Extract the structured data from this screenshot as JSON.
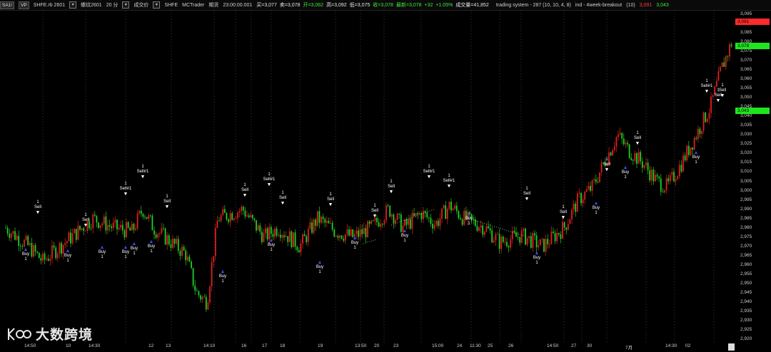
{
  "header": {
    "symbol_badge": "SA1!",
    "mode_badge": "VP",
    "symbol": "SHFE.rb 2601",
    "contract": "螺纹2601",
    "period": "20 分",
    "tabs_label": "成交价",
    "exchange": "SHFE",
    "app": "MCTrader",
    "sim": "期货",
    "time": "23:00:00.001",
    "fields": [
      {
        "label": "买",
        "value": "3,077",
        "tone": "w"
      },
      {
        "label": "卖",
        "value": "3,078",
        "tone": "w"
      },
      {
        "label": "开",
        "value": "3,062",
        "tone": "g"
      },
      {
        "label": "高",
        "value": "3,092",
        "tone": "w"
      },
      {
        "label": "低",
        "value": "3,075",
        "tone": "w"
      },
      {
        "label": "收",
        "value": "3,078",
        "tone": "g"
      },
      {
        "label": "最新",
        "value": "3,078",
        "tone": "g"
      },
      {
        "label": "",
        "value": "+32",
        "tone": "g"
      },
      {
        "label": "",
        "value": "+1.05%",
        "tone": "g"
      },
      {
        "label": "成交量",
        "value": "41,852",
        "tone": "w"
      }
    ],
    "strategy": "trading system - 287 (10, 10, 4, 8)",
    "indicator": "ind - 4week-breakout",
    "indicator_params": "(10)",
    "upper_value": "3,091",
    "lower_value": "3,043"
  },
  "price_axis": {
    "ticks": [
      "3,095",
      "3,090",
      "3,085",
      "3,080",
      "3,075",
      "3,070",
      "3,065",
      "3,060",
      "3,055",
      "3,050",
      "3,045",
      "3,040",
      "3,035",
      "3,030",
      "3,025",
      "3,020",
      "3,015",
      "3,010",
      "3,005",
      "3,000",
      "2,995",
      "2,990",
      "2,985",
      "2,980",
      "2,975",
      "2,970",
      "2,965",
      "2,960",
      "2,955",
      "2,950",
      "2,945",
      "2,940",
      "2,935",
      "2,930",
      "2,925",
      "2,920"
    ],
    "upper_badge": "3,091",
    "last_badge": "3,078",
    "lower_badge": "3,043",
    "colors": {
      "upper": "#ff2a2a",
      "last": "#1ee61e",
      "lower": "#1ee61e"
    }
  },
  "time_axis": {
    "labels": [
      "14:50",
      "10",
      "14:30",
      "12",
      "13",
      "14:10",
      "16",
      "17",
      "18",
      "19",
      "13:50",
      "20",
      "23",
      "15:00",
      "24",
      "11:30",
      "25",
      "26",
      "14:50",
      "27",
      "30",
      "7月",
      "14:30",
      "02"
    ]
  },
  "signals": {
    "buy": [
      {
        "label": "Buy",
        "qty": "1"
      },
      {
        "label": "Buy",
        "qty": "1"
      },
      {
        "label": "Buy",
        "qty": "1"
      },
      {
        "label": "Buy",
        "qty": "1"
      },
      {
        "label": "Buy",
        "qty": "1"
      },
      {
        "label": "Buy",
        "qty": "1"
      },
      {
        "label": "Buy",
        "qty": "1"
      },
      {
        "label": "Buy",
        "qty": "1"
      },
      {
        "label": "Buy",
        "qty": "1"
      },
      {
        "label": "Buy",
        "qty": "1"
      },
      {
        "label": "Buy",
        "qty": "1"
      },
      {
        "label": "Buy",
        "qty": "1"
      },
      {
        "label": "Buy",
        "qty": "1"
      },
      {
        "label": "Buy",
        "qty": "1"
      },
      {
        "label": "Buy",
        "qty": "1"
      },
      {
        "label": "Buy",
        "qty": "1"
      }
    ],
    "sell": [
      {
        "label": "Sell",
        "qty": "1"
      },
      {
        "label": "Sell",
        "qty": "1"
      },
      {
        "label": "Sell#1",
        "qty": "1"
      },
      {
        "label": "Sell#1",
        "qty": "1"
      },
      {
        "label": "Sell",
        "qty": "1"
      },
      {
        "label": "Sell",
        "qty": "1"
      },
      {
        "label": "Sell#1",
        "qty": "1"
      },
      {
        "label": "Sell",
        "qty": "1"
      },
      {
        "label": "Sell",
        "qty": "1"
      },
      {
        "label": "Sell",
        "qty": "1"
      },
      {
        "label": "Sell",
        "qty": "1"
      },
      {
        "label": "Sell#1",
        "qty": "1"
      },
      {
        "label": "Sell#1",
        "qty": "1"
      },
      {
        "label": "Sell",
        "qty": "1"
      },
      {
        "label": "Sell",
        "qty": "1"
      },
      {
        "label": "Sell",
        "qty": "1"
      },
      {
        "label": "Sell",
        "qty": "1"
      },
      {
        "label": "Sell",
        "qty": "1"
      },
      {
        "label": "Sell",
        "qty": "1"
      },
      {
        "label": "Sell#1",
        "qty": "1"
      }
    ]
  },
  "watermark": {
    "brand": "大数跨境",
    "logo_icon": "k100-logo-icon"
  }
}
